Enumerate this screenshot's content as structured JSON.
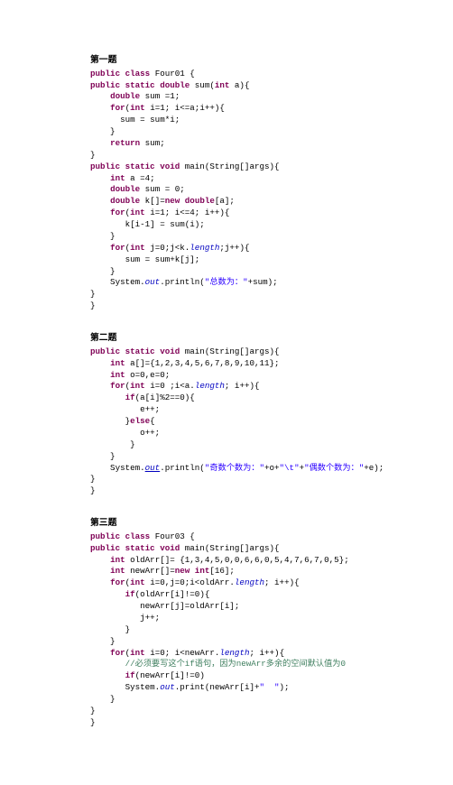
{
  "sections": [
    {
      "heading": "第一题",
      "lines": [
        [
          {
            "t": "public class ",
            "c": "kw"
          },
          {
            "t": "Four01 {",
            "c": "plain"
          }
        ],
        [
          {
            "t": "public static double ",
            "c": "kw"
          },
          {
            "t": "sum(",
            "c": "plain"
          },
          {
            "t": "int ",
            "c": "kw"
          },
          {
            "t": "a){",
            "c": "plain"
          }
        ],
        [
          {
            "t": "    ",
            "c": "plain"
          },
          {
            "t": "double ",
            "c": "kw"
          },
          {
            "t": "sum =1;",
            "c": "plain"
          }
        ],
        [
          {
            "t": "    ",
            "c": "plain"
          },
          {
            "t": "for",
            "c": "kw"
          },
          {
            "t": "(",
            "c": "plain"
          },
          {
            "t": "int ",
            "c": "kw"
          },
          {
            "t": "i=1; i<=a;i++){",
            "c": "plain"
          }
        ],
        [
          {
            "t": "      sum = sum*i;",
            "c": "plain"
          }
        ],
        [
          {
            "t": "    }",
            "c": "plain"
          }
        ],
        [
          {
            "t": "    ",
            "c": "plain"
          },
          {
            "t": "return ",
            "c": "kw"
          },
          {
            "t": "sum;",
            "c": "plain"
          }
        ],
        [
          {
            "t": "}",
            "c": "plain"
          }
        ],
        [
          {
            "t": "public static void ",
            "c": "kw"
          },
          {
            "t": "main(String[]args){",
            "c": "plain"
          }
        ],
        [
          {
            "t": "    ",
            "c": "plain"
          },
          {
            "t": "int ",
            "c": "kw"
          },
          {
            "t": "a =4;",
            "c": "plain"
          }
        ],
        [
          {
            "t": "    ",
            "c": "plain"
          },
          {
            "t": "double ",
            "c": "kw"
          },
          {
            "t": "sum = 0;",
            "c": "plain"
          }
        ],
        [
          {
            "t": "    ",
            "c": "plain"
          },
          {
            "t": "double ",
            "c": "kw"
          },
          {
            "t": "k[]=",
            "c": "plain"
          },
          {
            "t": "new double",
            "c": "kw"
          },
          {
            "t": "[a];",
            "c": "plain"
          }
        ],
        [
          {
            "t": "    ",
            "c": "plain"
          },
          {
            "t": "for",
            "c": "kw"
          },
          {
            "t": "(",
            "c": "plain"
          },
          {
            "t": "int ",
            "c": "kw"
          },
          {
            "t": "i=1; i<=4; i++){",
            "c": "plain"
          }
        ],
        [
          {
            "t": "       k[i-1] = ",
            "c": "plain"
          },
          {
            "t": "sum",
            "c": "plain"
          },
          {
            "t": "(i);",
            "c": "plain"
          }
        ],
        [
          {
            "t": "    }",
            "c": "plain"
          }
        ],
        [
          {
            "t": "    ",
            "c": "plain"
          },
          {
            "t": "for",
            "c": "kw"
          },
          {
            "t": "(",
            "c": "plain"
          },
          {
            "t": "int ",
            "c": "kw"
          },
          {
            "t": "j=0;j<k.",
            "c": "plain"
          },
          {
            "t": "length",
            "c": "field"
          },
          {
            "t": ";j++){",
            "c": "plain"
          }
        ],
        [
          {
            "t": "       sum = sum+k[j];",
            "c": "plain"
          }
        ],
        [
          {
            "t": "    }",
            "c": "plain"
          }
        ],
        [
          {
            "t": "    System.",
            "c": "plain"
          },
          {
            "t": "out",
            "c": "field"
          },
          {
            "t": ".println(",
            "c": "plain"
          },
          {
            "t": "\"总数为：\"",
            "c": "str"
          },
          {
            "t": "+sum);",
            "c": "plain"
          }
        ],
        [
          {
            "t": "}",
            "c": "plain"
          }
        ],
        [
          {
            "t": "}",
            "c": "plain"
          }
        ]
      ]
    },
    {
      "heading": "第二题",
      "lines": [
        [
          {
            "t": "public static void ",
            "c": "kw"
          },
          {
            "t": "main(String[]args){",
            "c": "plain"
          }
        ],
        [
          {
            "t": "    ",
            "c": "plain"
          },
          {
            "t": "int ",
            "c": "kw"
          },
          {
            "t": "a[]={1,2,3,4,5,6,7,8,9,10,11};",
            "c": "plain"
          }
        ],
        [
          {
            "t": "    ",
            "c": "plain"
          },
          {
            "t": "int ",
            "c": "kw"
          },
          {
            "t": "o=0,e=0;",
            "c": "plain"
          }
        ],
        [
          {
            "t": "    ",
            "c": "plain"
          },
          {
            "t": "for",
            "c": "kw"
          },
          {
            "t": "(",
            "c": "plain"
          },
          {
            "t": "int ",
            "c": "kw"
          },
          {
            "t": "i=0 ;i<a.",
            "c": "plain"
          },
          {
            "t": "length",
            "c": "field"
          },
          {
            "t": "; i++){",
            "c": "plain"
          }
        ],
        [
          {
            "t": "       ",
            "c": "plain"
          },
          {
            "t": "if",
            "c": "kw"
          },
          {
            "t": "(a[i]%2==0){",
            "c": "plain"
          }
        ],
        [
          {
            "t": "          e++;",
            "c": "plain"
          }
        ],
        [
          {
            "t": "       }",
            "c": "plain"
          },
          {
            "t": "else",
            "c": "kw"
          },
          {
            "t": "{",
            "c": "plain"
          }
        ],
        [
          {
            "t": "          o++;",
            "c": "plain"
          }
        ],
        [
          {
            "t": "        }",
            "c": "plain"
          }
        ],
        [
          {
            "t": "    }",
            "c": "plain"
          }
        ],
        [
          {
            "t": "    System.",
            "c": "plain"
          },
          {
            "t": "out",
            "c": "field under"
          },
          {
            "t": ".println(",
            "c": "plain"
          },
          {
            "t": "\"奇数个数为：\"",
            "c": "str"
          },
          {
            "t": "+o+",
            "c": "plain"
          },
          {
            "t": "\"\\t\"",
            "c": "str"
          },
          {
            "t": "+",
            "c": "plain"
          },
          {
            "t": "\"偶数个数为：\"",
            "c": "str"
          },
          {
            "t": "+e);",
            "c": "plain"
          }
        ],
        [
          {
            "t": "}",
            "c": "plain"
          }
        ],
        [
          {
            "t": "}",
            "c": "plain"
          }
        ]
      ]
    },
    {
      "heading": "第三题",
      "lines": [
        [
          {
            "t": "public class ",
            "c": "kw"
          },
          {
            "t": "Four03 {",
            "c": "plain"
          }
        ],
        [
          {
            "t": "public static void ",
            "c": "kw"
          },
          {
            "t": "main(String[]args){",
            "c": "plain"
          }
        ],
        [
          {
            "t": "    ",
            "c": "plain"
          },
          {
            "t": "int ",
            "c": "kw"
          },
          {
            "t": "oldArr[]= {1,3,4,5,0,0,6,6,0,5,4,7,6,7,0,5};",
            "c": "plain"
          }
        ],
        [
          {
            "t": "    ",
            "c": "plain"
          },
          {
            "t": "int ",
            "c": "kw"
          },
          {
            "t": "newArr[]=",
            "c": "plain"
          },
          {
            "t": "new int",
            "c": "kw"
          },
          {
            "t": "[16];",
            "c": "plain"
          }
        ],
        [
          {
            "t": "    ",
            "c": "plain"
          },
          {
            "t": "for",
            "c": "kw"
          },
          {
            "t": "(",
            "c": "plain"
          },
          {
            "t": "int ",
            "c": "kw"
          },
          {
            "t": "i=0,j=0;i<oldArr.",
            "c": "plain"
          },
          {
            "t": "length",
            "c": "field"
          },
          {
            "t": "; i++){",
            "c": "plain"
          }
        ],
        [
          {
            "t": "       ",
            "c": "plain"
          },
          {
            "t": "if",
            "c": "kw"
          },
          {
            "t": "(oldArr[i]!=0){",
            "c": "plain"
          }
        ],
        [
          {
            "t": "          newArr[j]=oldArr[i];",
            "c": "plain"
          }
        ],
        [
          {
            "t": "          j++;",
            "c": "plain"
          }
        ],
        [
          {
            "t": "       }",
            "c": "plain"
          }
        ],
        [
          {
            "t": "    }",
            "c": "plain"
          }
        ],
        [
          {
            "t": "    ",
            "c": "plain"
          },
          {
            "t": "for",
            "c": "kw"
          },
          {
            "t": "(",
            "c": "plain"
          },
          {
            "t": "int ",
            "c": "kw"
          },
          {
            "t": "i=0; i<newArr.",
            "c": "plain"
          },
          {
            "t": "length",
            "c": "field"
          },
          {
            "t": "; i++){",
            "c": "plain"
          }
        ],
        [
          {
            "t": "       ",
            "c": "plain"
          },
          {
            "t": "//必须要写这个if语句，因为newArr多余的空间默认值为0",
            "c": "comment"
          }
        ],
        [
          {
            "t": "       ",
            "c": "plain"
          },
          {
            "t": "if",
            "c": "kw"
          },
          {
            "t": "(newArr[i]!=0)",
            "c": "plain"
          }
        ],
        [
          {
            "t": "       System.",
            "c": "plain"
          },
          {
            "t": "out",
            "c": "field"
          },
          {
            "t": ".print(newArr[i]+",
            "c": "plain"
          },
          {
            "t": "\"  \"",
            "c": "str"
          },
          {
            "t": ");",
            "c": "plain"
          }
        ],
        [
          {
            "t": "    }",
            "c": "plain"
          }
        ],
        [
          {
            "t": "}",
            "c": "plain"
          }
        ],
        [
          {
            "t": "}",
            "c": "plain"
          }
        ]
      ]
    }
  ]
}
